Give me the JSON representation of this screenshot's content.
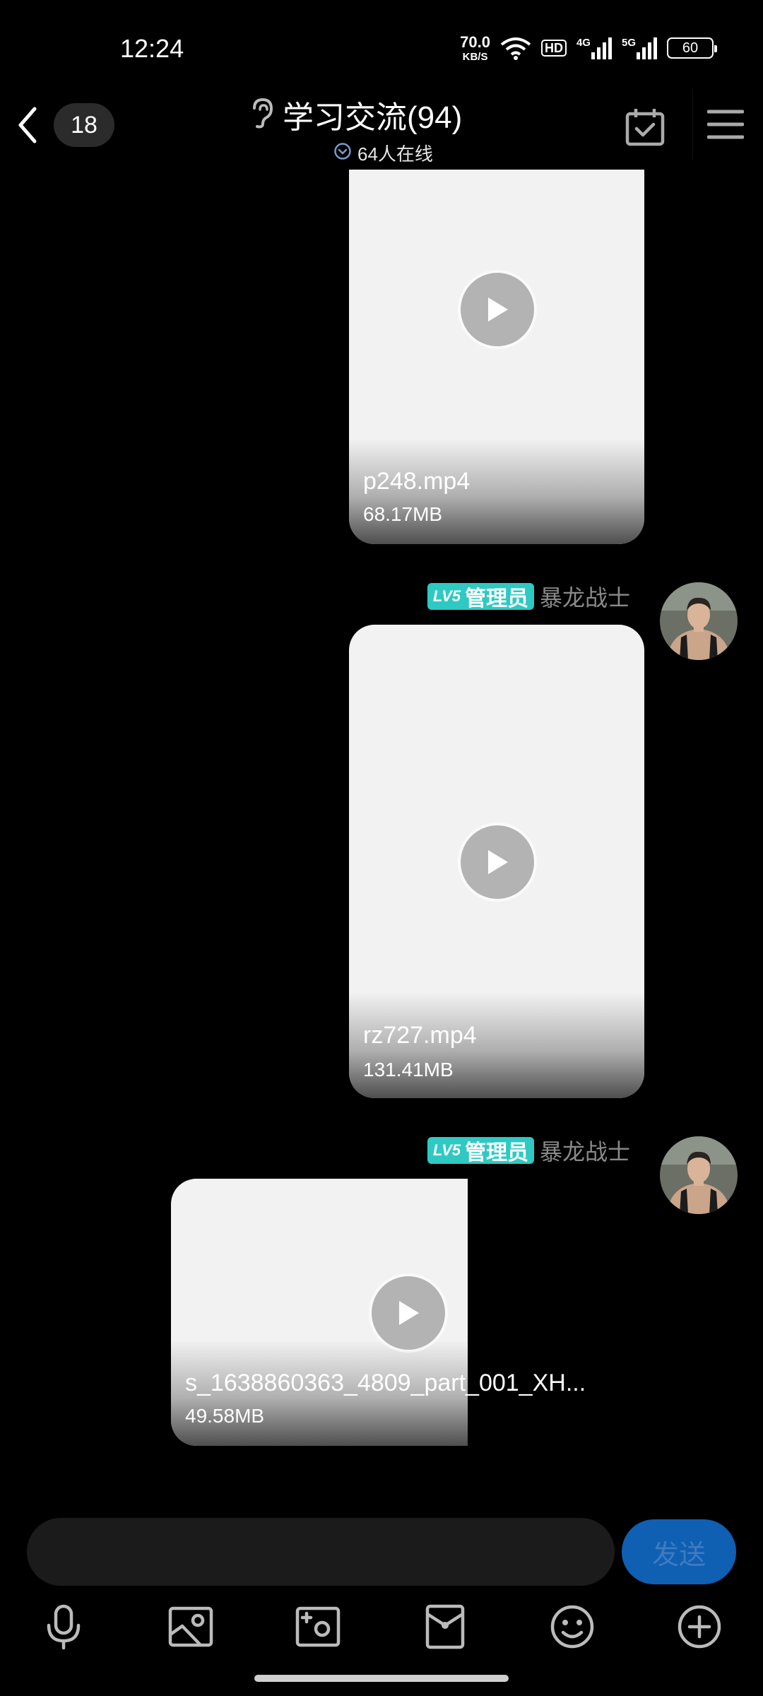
{
  "status_bar": {
    "time": "12:24",
    "net_speed": "70.0",
    "net_unit": "KB/S",
    "hd_label": "HD",
    "signal1_label": "4G",
    "signal2_label": "5G",
    "battery": "60"
  },
  "header": {
    "unread_count": "18",
    "title": "学习交流(94)",
    "online": "64人在线"
  },
  "messages": [
    {
      "file_name": "p248.mp4",
      "file_size": "68.17MB"
    },
    {
      "sender_level": "LV5",
      "sender_role": "管理员",
      "sender_name": "暴龙战士",
      "file_name": "rz727.mp4",
      "file_size": "131.41MB"
    },
    {
      "sender_level": "LV5",
      "sender_role": "管理员",
      "sender_name": "暴龙战士",
      "file_name": "s_1638860363_4809_part_001_XH...",
      "file_size": "49.58MB"
    }
  ],
  "composer": {
    "input_value": "",
    "send_label": "发送"
  },
  "toolbar_icons": [
    "microphone-icon",
    "image-icon",
    "camera-icon",
    "red-packet-icon",
    "emoji-icon",
    "plus-icon"
  ],
  "colors": {
    "background": "#000000",
    "admin_badge": "#2ec9c2",
    "send_button": "#0f5fb3",
    "bubble": "#f2f2f2"
  }
}
